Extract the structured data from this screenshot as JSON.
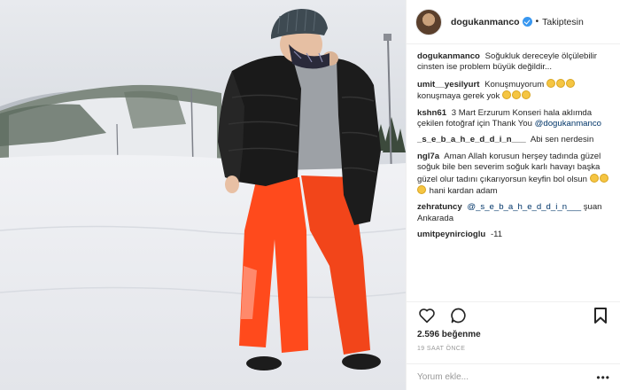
{
  "header": {
    "username": "dogukanmanco",
    "follow_state": "Takiptesin",
    "separator": "•"
  },
  "comments": [
    {
      "user": "dogukanmanco",
      "text": "Soğukluk dereceyle ölçülebilir cinsten ise problem büyük değildir..."
    },
    {
      "user": "umit__yesilyurt",
      "text_a": "Konuşmuyorum",
      "text_b": "konuşmaya gerek yok"
    },
    {
      "user": "kshn61",
      "text": "3 Mart Erzurum Konseri hala aklımda çekilen fotoğraf için Thank You",
      "mention": "@dogukanmanco"
    },
    {
      "user": "_s_e_b_a_h_e_d_d_i_n___",
      "text": "Abi sen nerdesin"
    },
    {
      "user": "ngl7a",
      "text": "Aman Allah korusun herşey tadında güzel soğuk bile ben severim soğuk karlı havayı başka güzel olur tadını çıkarıyorsun keyfin bol olsun",
      "text_b": "hani kardan adam"
    },
    {
      "user": "zehratuncy",
      "mention": "@_s_e_b_a_h_e_d_d_i_n___",
      "text": "şuan Ankarada"
    },
    {
      "user": "umitpeynircioglu",
      "text": "-11"
    }
  ],
  "likes": "2.596 beğenme",
  "timestamp": "19 SAAT ÖNCE",
  "add_comment": {
    "placeholder": "Yorum ekle..."
  },
  "more_label": "•••",
  "icons": {
    "like": "heart-icon",
    "comment": "speech-bubble-icon",
    "save": "bookmark-icon",
    "verified": "verified-badge-icon"
  },
  "colors": {
    "verified": "#3897f0",
    "mention": "#003569",
    "jacket": "#1a1a1a",
    "pants": "#ff4a1c",
    "snow": "#f4f5f7"
  }
}
